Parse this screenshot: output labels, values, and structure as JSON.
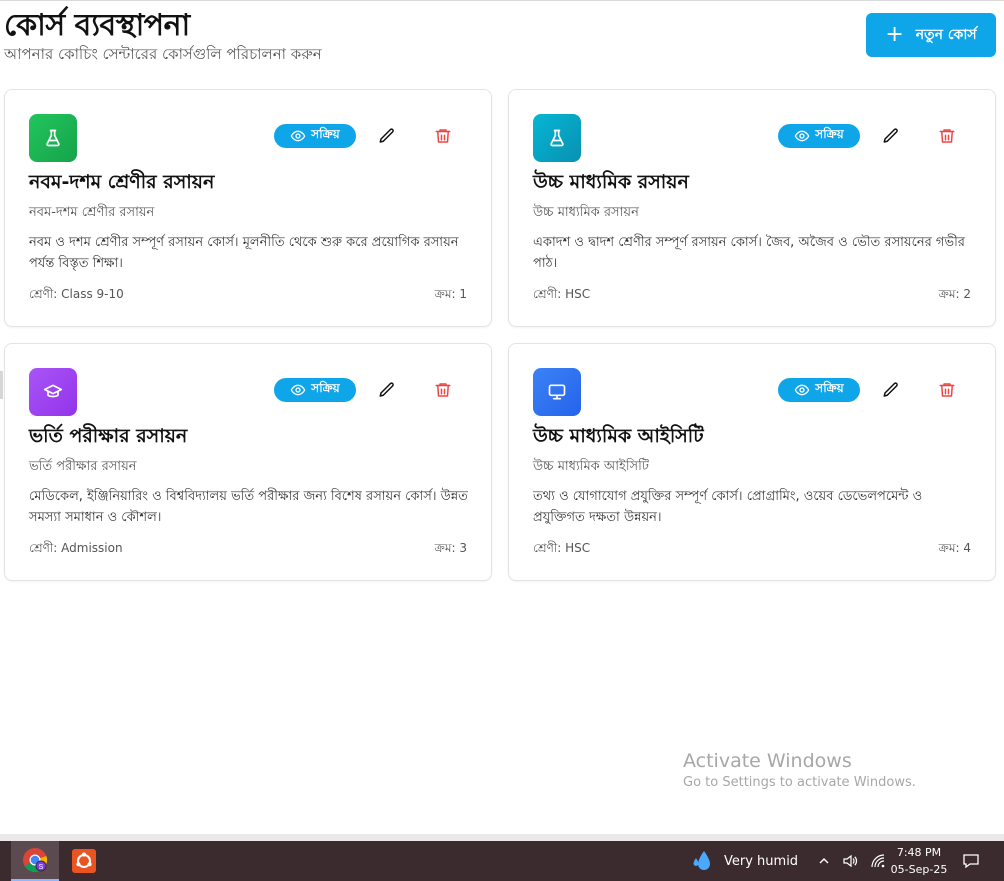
{
  "header": {
    "title": "কোর্স ব্যবস্থাপনা",
    "subtitle": "আপনার কোচিং সেন্টারের কোর্সগুলি পরিচালনা করুন",
    "new_course_label": "নতুন কোর্স"
  },
  "courses": [
    {
      "icon": "flask-icon",
      "icon_color": "#22c55e",
      "status": "সক্রিয়",
      "title": "নবম-দশম শ্রেণীর রসায়ন",
      "subtitle": "নবম-দশম শ্রেণীর রসায়ন",
      "description": "নবম ও দশম শ্রেণীর সম্পূর্ণ রসায়ন কোর্স। মূলনীতি থেকে শুরু করে প্রয়োগিক রসায়ন পর্যন্ত বিস্তৃত শিক্ষা।",
      "class_label": "শ্রেণী: Class 9-10",
      "order_label": "ক্রম: 1"
    },
    {
      "icon": "flask-icon",
      "icon_color": "#06b6d4",
      "status": "সক্রিয়",
      "title": "উচ্চ মাধ্যমিক রসায়ন",
      "subtitle": "উচ্চ মাধ্যমিক রসায়ন",
      "description": "একাদশ ও দ্বাদশ শ্রেণীর সম্পূর্ণ রসায়ন কোর্স। জৈব, অজৈব ও ভৌত রসায়নের গভীর পাঠ।",
      "class_label": "শ্রেণী: HSC",
      "order_label": "ক্রম: 2"
    },
    {
      "icon": "graduation-cap-icon",
      "icon_color": "#a855f7",
      "status": "সক্রিয়",
      "title": "ভর্তি পরীক্ষার রসায়ন",
      "subtitle": "ভর্তি পরীক্ষার রসায়ন",
      "description": "মেডিকেল, ইঞ্জিনিয়ারিং ও বিশ্ববিদ্যালয় ভর্তি পরীক্ষার জন্য বিশেষ রসায়ন কোর্স। উন্নত সমস্যা সমাধান ও কৌশল।",
      "class_label": "শ্রেণী: Admission",
      "order_label": "ক্রম: 3"
    },
    {
      "icon": "monitor-icon",
      "icon_color": "#3b82f6",
      "status": "সক্রিয়",
      "title": "উচ্চ মাধ্যমিক আইসিটি",
      "subtitle": "উচ্চ মাধ্যমিক আইসিটি",
      "description": "তথ্য ও যোগাযোগ প্রযুক্তির সম্পূর্ণ কোর্স। প্রোগ্রামিং, ওয়েব ডেভেলপমেন্ট ও প্রযুক্তিগত দক্ষতা উন্নয়ন।",
      "class_label": "শ্রেণী: HSC",
      "order_label": "ক্রম: 4"
    }
  ],
  "colors": {
    "accent": "#0ea5e9",
    "delete": "#ef4444"
  },
  "watermark": {
    "title": "Activate Windows",
    "subtitle": "Go to Settings to activate Windows."
  },
  "taskbar": {
    "weather": "Very humid",
    "time": "7:48 PM",
    "date": "05-Sep-25"
  }
}
